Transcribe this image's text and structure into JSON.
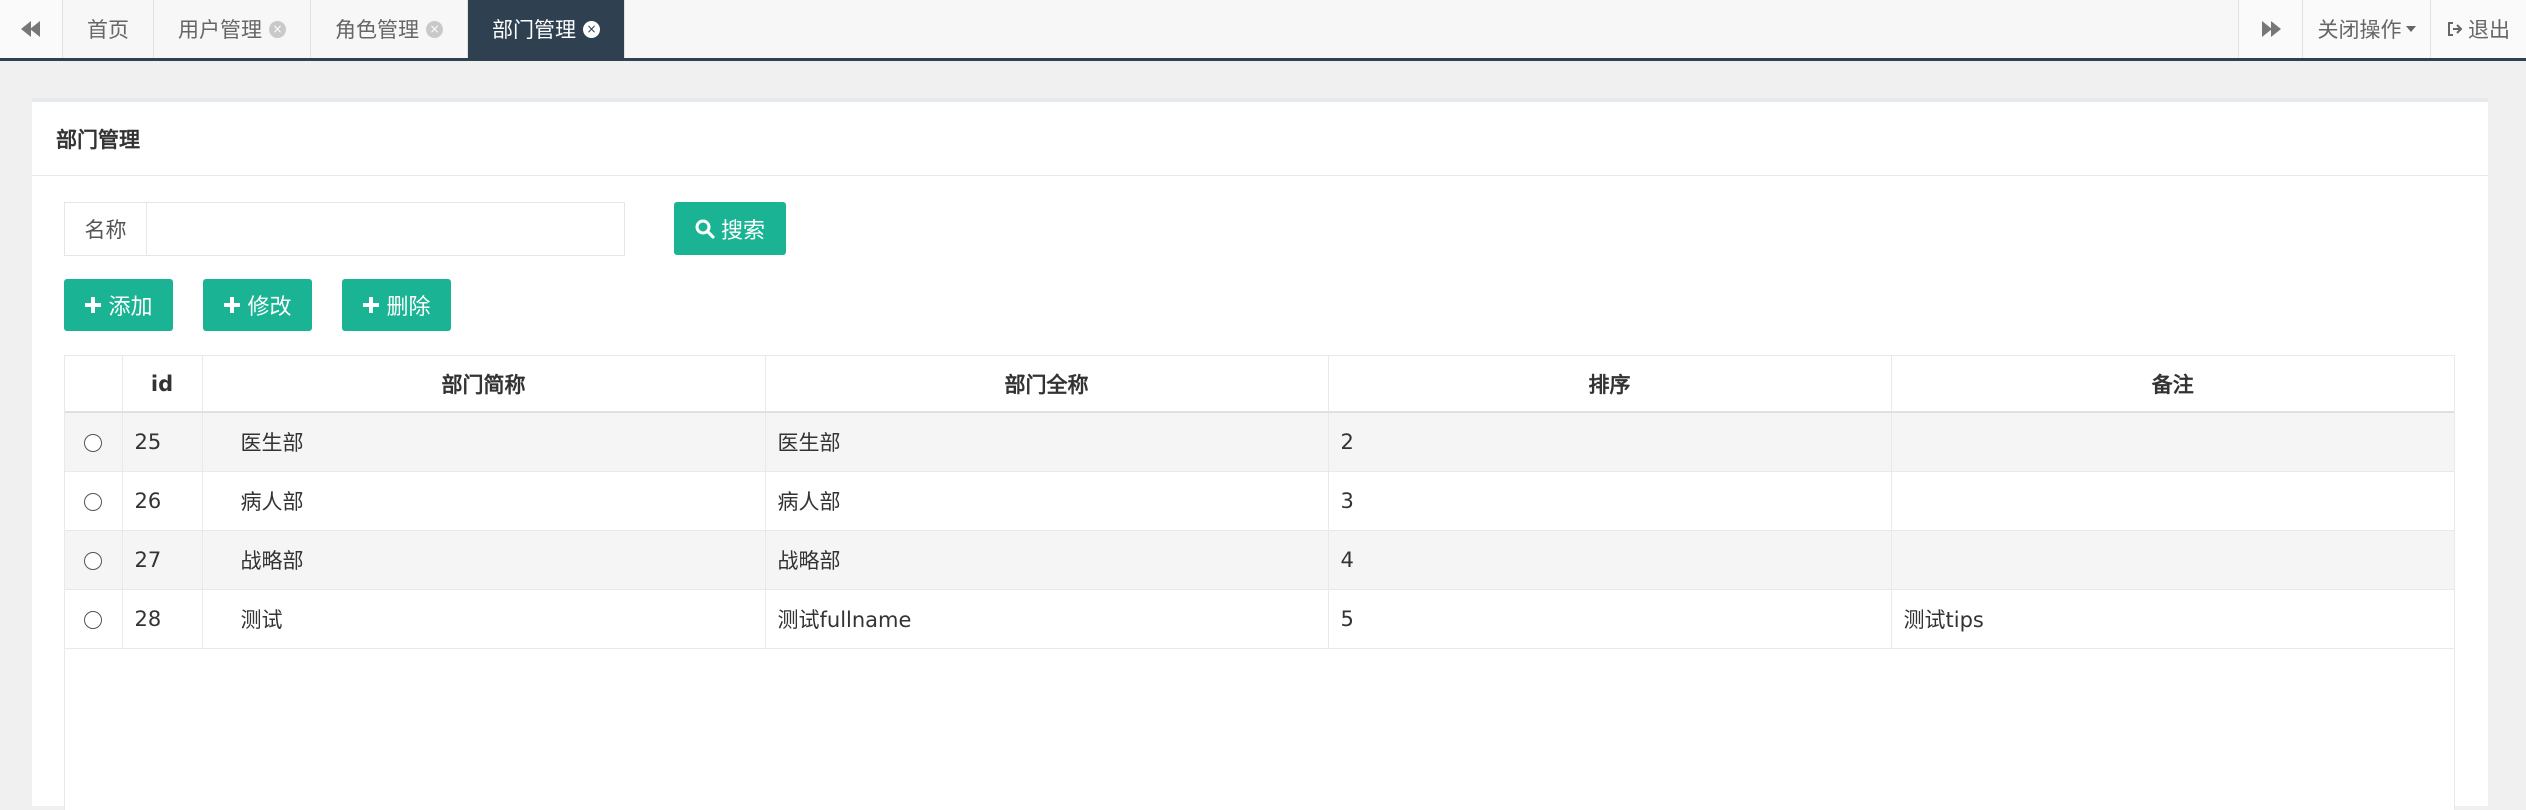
{
  "topbar": {
    "tabs": [
      {
        "label": "首页",
        "closable": false,
        "active": false
      },
      {
        "label": "用户管理",
        "closable": true,
        "active": false
      },
      {
        "label": "角色管理",
        "closable": true,
        "active": false
      },
      {
        "label": "部门管理",
        "closable": true,
        "active": true
      }
    ],
    "close_ops_label": "关闭操作",
    "logout_label": "退出",
    "active_color": "#2f4050"
  },
  "panel": {
    "title": "部门管理"
  },
  "search": {
    "name_label": "名称",
    "name_value": "",
    "button_label": "搜索"
  },
  "toolbar": {
    "add_label": "添加",
    "edit_label": "修改",
    "delete_label": "删除",
    "accent": "#1ab394"
  },
  "table": {
    "columns": [
      "",
      "id",
      "部门简称",
      "部门全称",
      "排序",
      "备注"
    ],
    "rows": [
      {
        "id": "25",
        "short": "医生部",
        "full": "医生部",
        "order": "2",
        "note": ""
      },
      {
        "id": "26",
        "short": "病人部",
        "full": "病人部",
        "order": "3",
        "note": ""
      },
      {
        "id": "27",
        "short": "战略部",
        "full": "战略部",
        "order": "4",
        "note": ""
      },
      {
        "id": "28",
        "short": "测试",
        "full": "测试fullname",
        "order": "5",
        "note": "测试tips"
      }
    ]
  }
}
